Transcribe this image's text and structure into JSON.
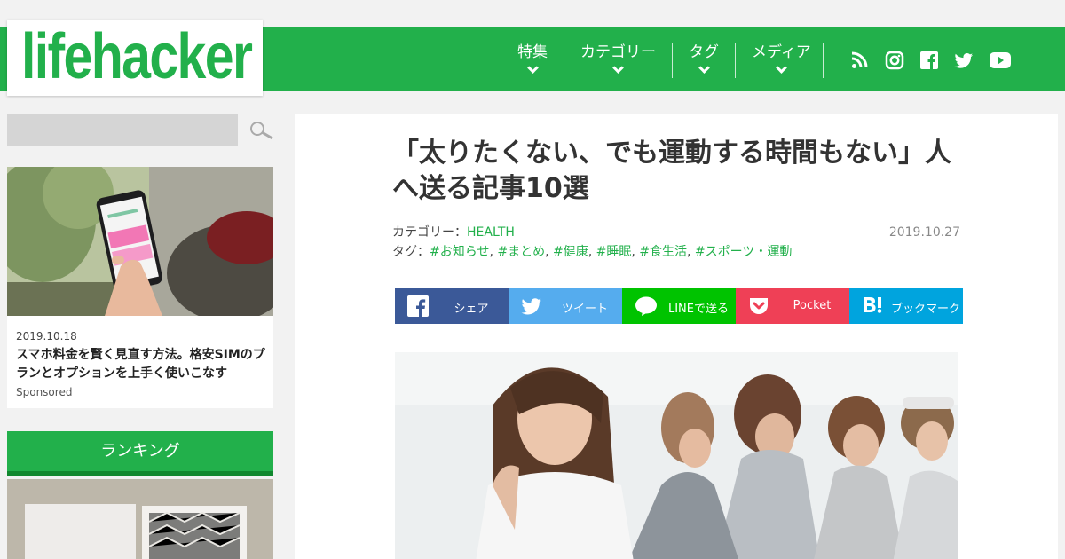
{
  "brand": {
    "logo_text": "lifehacker",
    "accent": "#22b04b"
  },
  "nav": {
    "items": [
      {
        "label": "特集"
      },
      {
        "label": "カテゴリー"
      },
      {
        "label": "タグ"
      },
      {
        "label": "メディア"
      }
    ],
    "social": [
      "rss-icon",
      "instagram-icon",
      "facebook-icon",
      "twitter-icon",
      "youtube-icon"
    ]
  },
  "sidebar": {
    "search_placeholder": "",
    "ad": {
      "date": "2019.10.18",
      "title": "スマホ料金を賢く見直す方法。格安SIMのプランとオプションを上手く使いこなす",
      "sponsor": "Sponsored"
    },
    "ranking_title": "ランキング"
  },
  "article": {
    "title": "「太りたくない、でも運動する時間もない」人へ送る記事10選",
    "category_label": "カテゴリー：",
    "category": "HEALTH",
    "tags_label": "タグ：",
    "tags": [
      "#お知らせ",
      "#まとめ",
      "#健康",
      "#睡眠",
      "#食生活",
      "#スポーツ・運動"
    ],
    "date": "2019.10.27"
  },
  "share": [
    {
      "label": "シェア",
      "icon": "facebook-icon",
      "color": "#3b5998"
    },
    {
      "label": "ツイート",
      "icon": "twitter-icon",
      "color": "#55acee"
    },
    {
      "label": "LINEで送る",
      "icon": "line-icon",
      "color": "#00c300"
    },
    {
      "label": "Pocket",
      "icon": "pocket-icon",
      "color": "#ef4056"
    },
    {
      "label": "ブックマーク",
      "icon": "hatena-bookmark-icon",
      "color": "#00a4de"
    }
  ]
}
